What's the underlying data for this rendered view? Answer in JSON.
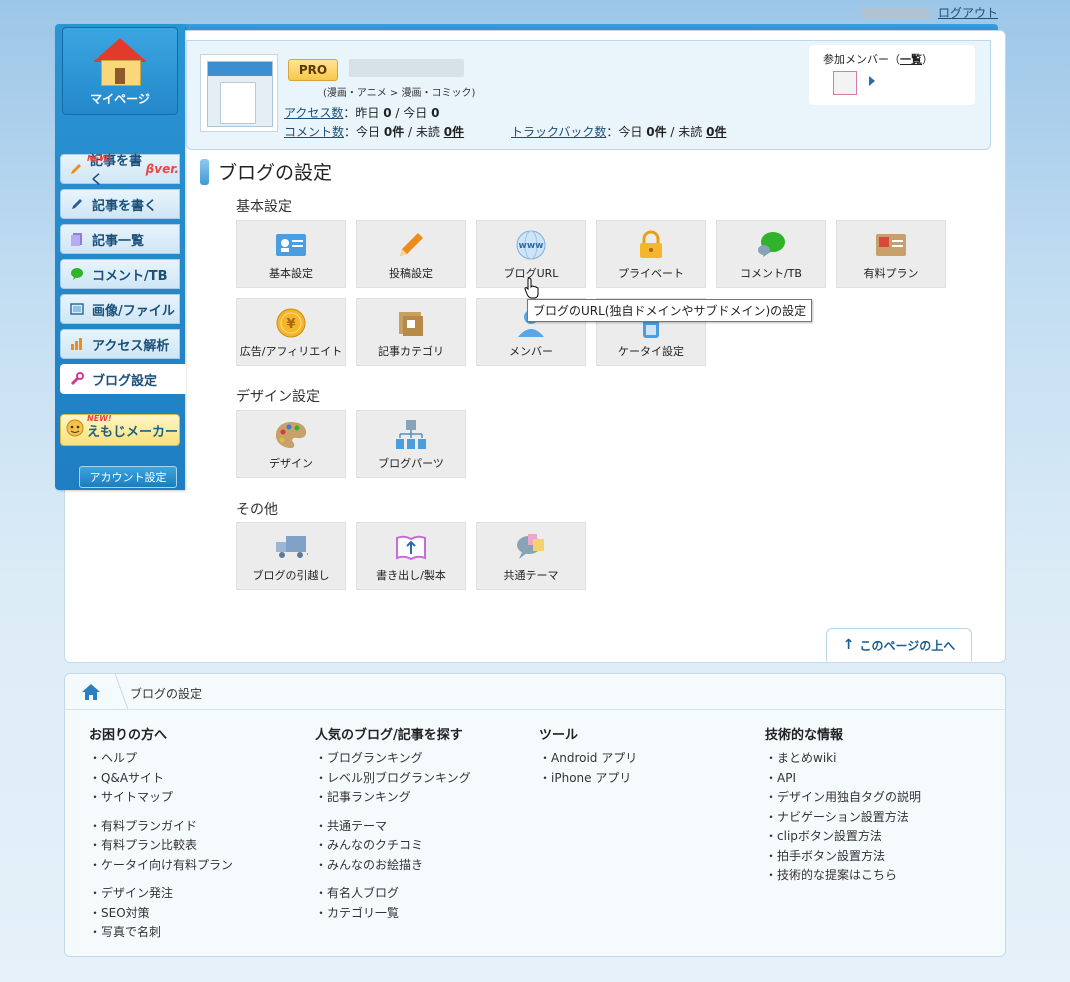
{
  "topbar": {
    "logout": "ログアウト"
  },
  "sidebar": {
    "mypage": "マイページ",
    "new_badge": "NEW!",
    "items": [
      {
        "label": "記事を書く",
        "beta": "βver."
      },
      {
        "label": "記事を書く"
      },
      {
        "label": "記事一覧"
      },
      {
        "label": "コメント/TB"
      },
      {
        "label": "画像/ファイル"
      },
      {
        "label": "アクセス解析"
      },
      {
        "label": "ブログ設定"
      }
    ],
    "emoji": "えもじメーカー",
    "account": "アカウント設定"
  },
  "blog": {
    "pro": "PRO",
    "genre": "(漫画・アニメ > 漫画・コミック)",
    "access_label": "アクセス数",
    "access_text": "：昨日 ",
    "access_yesterday": "0",
    "access_sep": " / 今日 ",
    "access_today": "0",
    "comment_label": "コメント数",
    "comment_text": "：今日 ",
    "comment_today": "0件",
    "comment_sep": " / 未読 ",
    "comment_unread": "0件",
    "tb_label": "トラックバック数",
    "tb_text": "：今日 ",
    "tb_today": "0件",
    "tb_sep": " / 未読 ",
    "tb_unread": "0件",
    "members_label": "参加メンバー",
    "members_list": "一覧"
  },
  "page": {
    "title": "ブログの設定"
  },
  "sections": {
    "basic": "基本設定",
    "design": "デザイン設定",
    "other": "その他"
  },
  "tiles": {
    "basic": "基本設定",
    "post": "投稿設定",
    "url": "ブログURL",
    "private": "プライベート",
    "comment": "コメント/TB",
    "paid": "有料プラン",
    "ads": "広告/アフィリエイト",
    "category": "記事カテゴリ",
    "member": "メンバー",
    "mobile": "ケータイ設定",
    "design": "デザイン",
    "parts": "ブログパーツ",
    "move": "ブログの引越し",
    "export": "書き出し/製本",
    "theme": "共通テーマ"
  },
  "tooltip": "ブログのURL(独自ドメインやサブドメイン)の設定",
  "to_top": "このページの上へ",
  "breadcrumb": {
    "current": "ブログの設定"
  },
  "footer": {
    "cols": [
      {
        "title": "お困りの方へ",
        "groups": [
          [
            "ヘルプ",
            "Q&Aサイト",
            "サイトマップ"
          ],
          [
            "有料プランガイド",
            "有料プラン比較表",
            "ケータイ向け有料プラン"
          ],
          [
            "デザイン発注",
            "SEO対策",
            "写真で名刺"
          ]
        ]
      },
      {
        "title": "人気のブログ/記事を探す",
        "groups": [
          [
            "ブログランキング",
            "レベル別ブログランキング",
            "記事ランキング"
          ],
          [
            "共通テーマ",
            "みんなのクチコミ",
            "みんなのお絵描き"
          ],
          [
            "有名人ブログ",
            "カテゴリ一覧"
          ]
        ]
      },
      {
        "title": "ツール",
        "groups": [
          [
            "Android アプリ",
            "iPhone アプリ"
          ]
        ]
      },
      {
        "title": "技術的な情報",
        "groups": [
          [
            "まとめwiki",
            "API",
            "デザイン用独自タグの説明",
            "ナビゲーション設置方法",
            "clipボタン設置方法",
            "拍手ボタン設置方法",
            "技術的な提案はこちら"
          ]
        ]
      }
    ]
  },
  "colors": {
    "accent": "#2a95d3",
    "brand_dark": "#1a4f7a"
  }
}
